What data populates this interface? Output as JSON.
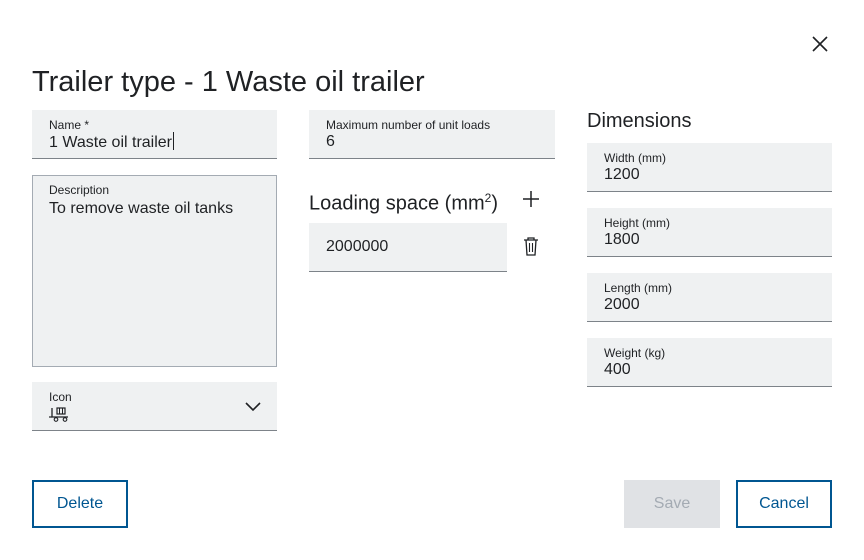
{
  "dialog": {
    "title": "Trailer type - 1 Waste oil trailer"
  },
  "fields": {
    "name": {
      "label": "Name *",
      "value": "1 Waste oil trailer"
    },
    "description": {
      "label": "Description",
      "value": "To remove waste oil tanks"
    },
    "icon": {
      "label": "Icon",
      "selected_icon": "trailer-icon"
    },
    "max_unit_loads": {
      "label": "Maximum number of unit loads",
      "value": "6"
    }
  },
  "loading_space": {
    "heading": "Loading space (mm",
    "heading_sup": "2",
    "heading_end": ")",
    "value": "2000000"
  },
  "dimensions": {
    "heading": "Dimensions",
    "width": {
      "label": "Width (mm)",
      "value": "1200"
    },
    "height": {
      "label": "Height (mm)",
      "value": "1800"
    },
    "length": {
      "label": "Length (mm)",
      "value": "2000"
    },
    "weight": {
      "label": "Weight (kg)",
      "value": "400"
    }
  },
  "buttons": {
    "delete": "Delete",
    "save": "Save",
    "cancel": "Cancel"
  },
  "colors": {
    "primary": "#005691",
    "field_bg": "#eff1f2",
    "disabled_bg": "#e0e2e5",
    "disabled_text": "#a4abb3"
  }
}
